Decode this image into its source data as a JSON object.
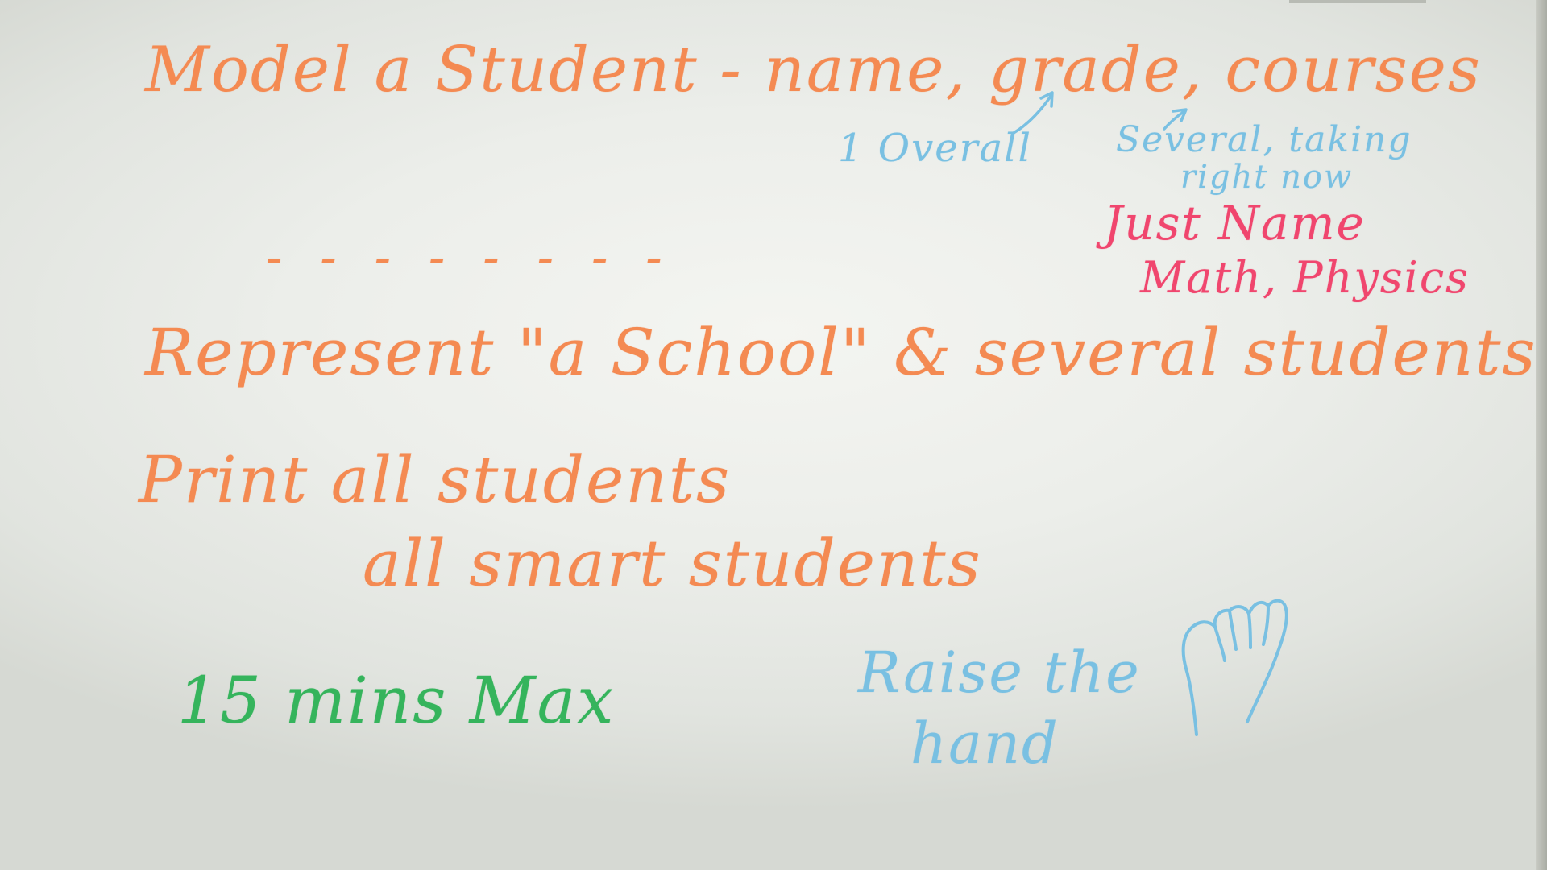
{
  "whiteboard": {
    "title_line": "Model a Student - name, grade, courses",
    "notes": {
      "grade_note": "1 Overall",
      "courses_note_line1": "Several, taking",
      "courses_note_line2": "right now",
      "just_name": "Just Name",
      "examples": "Math, Physics"
    },
    "divider": "- - - - - - - -",
    "task_school": "Represent \"a School\" & several students",
    "task_print_line1": "Print  all students",
    "task_print_line2": "all smart students",
    "time_limit": "15 mins Max",
    "raise_hand_line1": "Raise the",
    "raise_hand_line2": "hand",
    "ink_colors": {
      "orange": "#f48a52",
      "blue": "#79c0e2",
      "pink": "#f0466e",
      "green": "#35b45c"
    },
    "drawing": "raised-hand-icon"
  }
}
